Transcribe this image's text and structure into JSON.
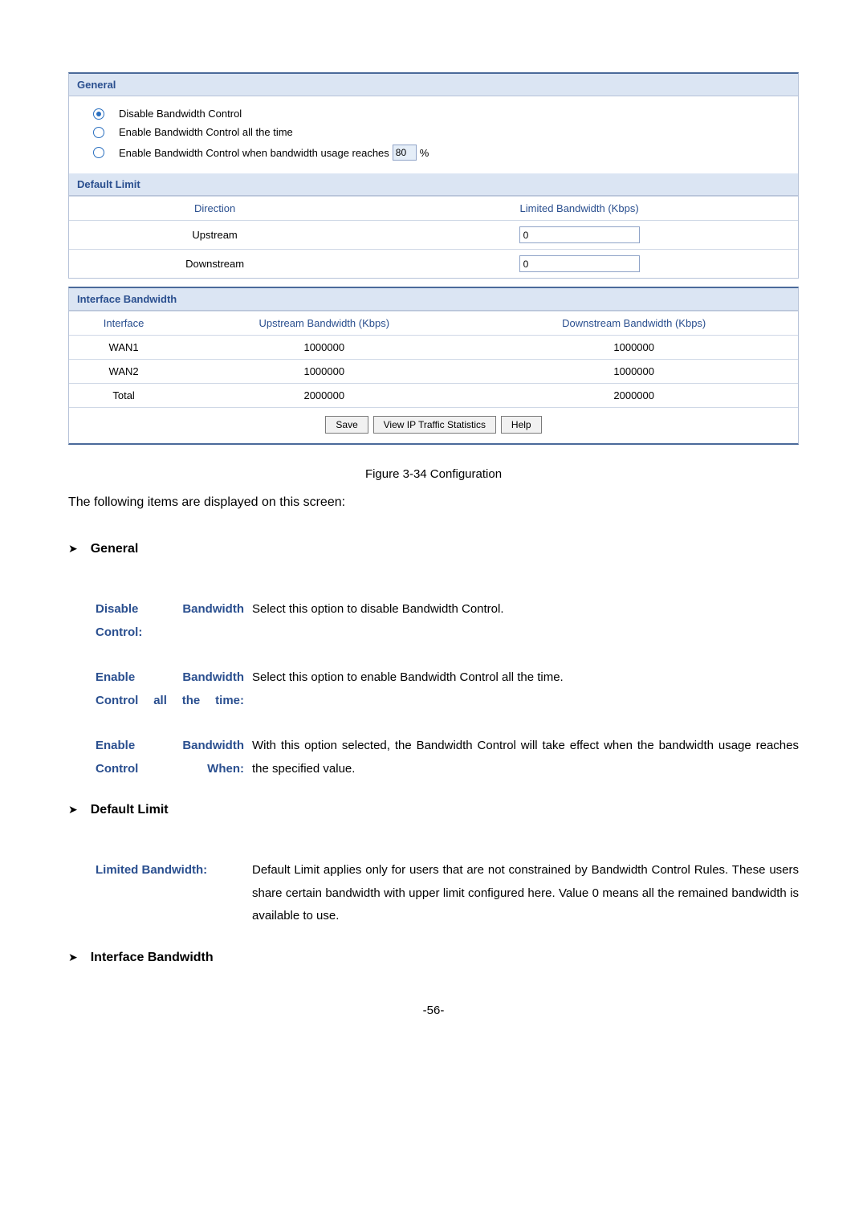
{
  "general": {
    "title": "General",
    "options": {
      "disable": "Disable Bandwidth Control",
      "enable_all": "Enable Bandwidth Control all the time",
      "enable_when_prefix": "Enable Bandwidth Control when bandwidth usage reaches",
      "threshold_value": "80",
      "threshold_unit": "%"
    }
  },
  "default_limit": {
    "title": "Default Limit",
    "col_direction": "Direction",
    "col_limited": "Limited Bandwidth (Kbps)",
    "rows": {
      "upstream": {
        "label": "Upstream",
        "value": "0"
      },
      "downstream": {
        "label": "Downstream",
        "value": "0"
      }
    }
  },
  "interface_bw": {
    "title": "Interface Bandwidth",
    "col_interface": "Interface",
    "col_up": "Upstream Bandwidth (Kbps)",
    "col_down": "Downstream Bandwidth (Kbps)",
    "rows": {
      "wan1": {
        "iface": "WAN1",
        "up": "1000000",
        "down": "1000000"
      },
      "wan2": {
        "iface": "WAN2",
        "up": "1000000",
        "down": "1000000"
      },
      "total": {
        "iface": "Total",
        "up": "2000000",
        "down": "2000000"
      }
    }
  },
  "buttons": {
    "save": "Save",
    "view_stats": "View IP Traffic Statistics",
    "help": "Help"
  },
  "caption": "Figure 3-34 Configuration",
  "intro": "The following items are displayed on this screen:",
  "sections": {
    "general": "General",
    "default_limit": "Default Limit",
    "interface_bw": "Interface Bandwidth"
  },
  "defs": {
    "disable_bc_term": "Disable Bandwidth Control:",
    "disable_bc_desc": "Select this option to disable Bandwidth Control.",
    "enable_all_term": "Enable Bandwidth Control all the time:",
    "enable_all_desc": "Select this option to enable Bandwidth Control all the time.",
    "enable_when_term": "Enable Bandwidth Control When:",
    "enable_when_desc": "With this option selected, the Bandwidth Control will take effect when the bandwidth usage reaches the specified value.",
    "limited_bw_term": "Limited Bandwidth:",
    "limited_bw_desc": "Default Limit applies only for users that are not constrained by Bandwidth Control Rules. These users share certain bandwidth with upper limit configured here. Value 0 means all the remained bandwidth is available to use."
  },
  "page_number": "-56-"
}
